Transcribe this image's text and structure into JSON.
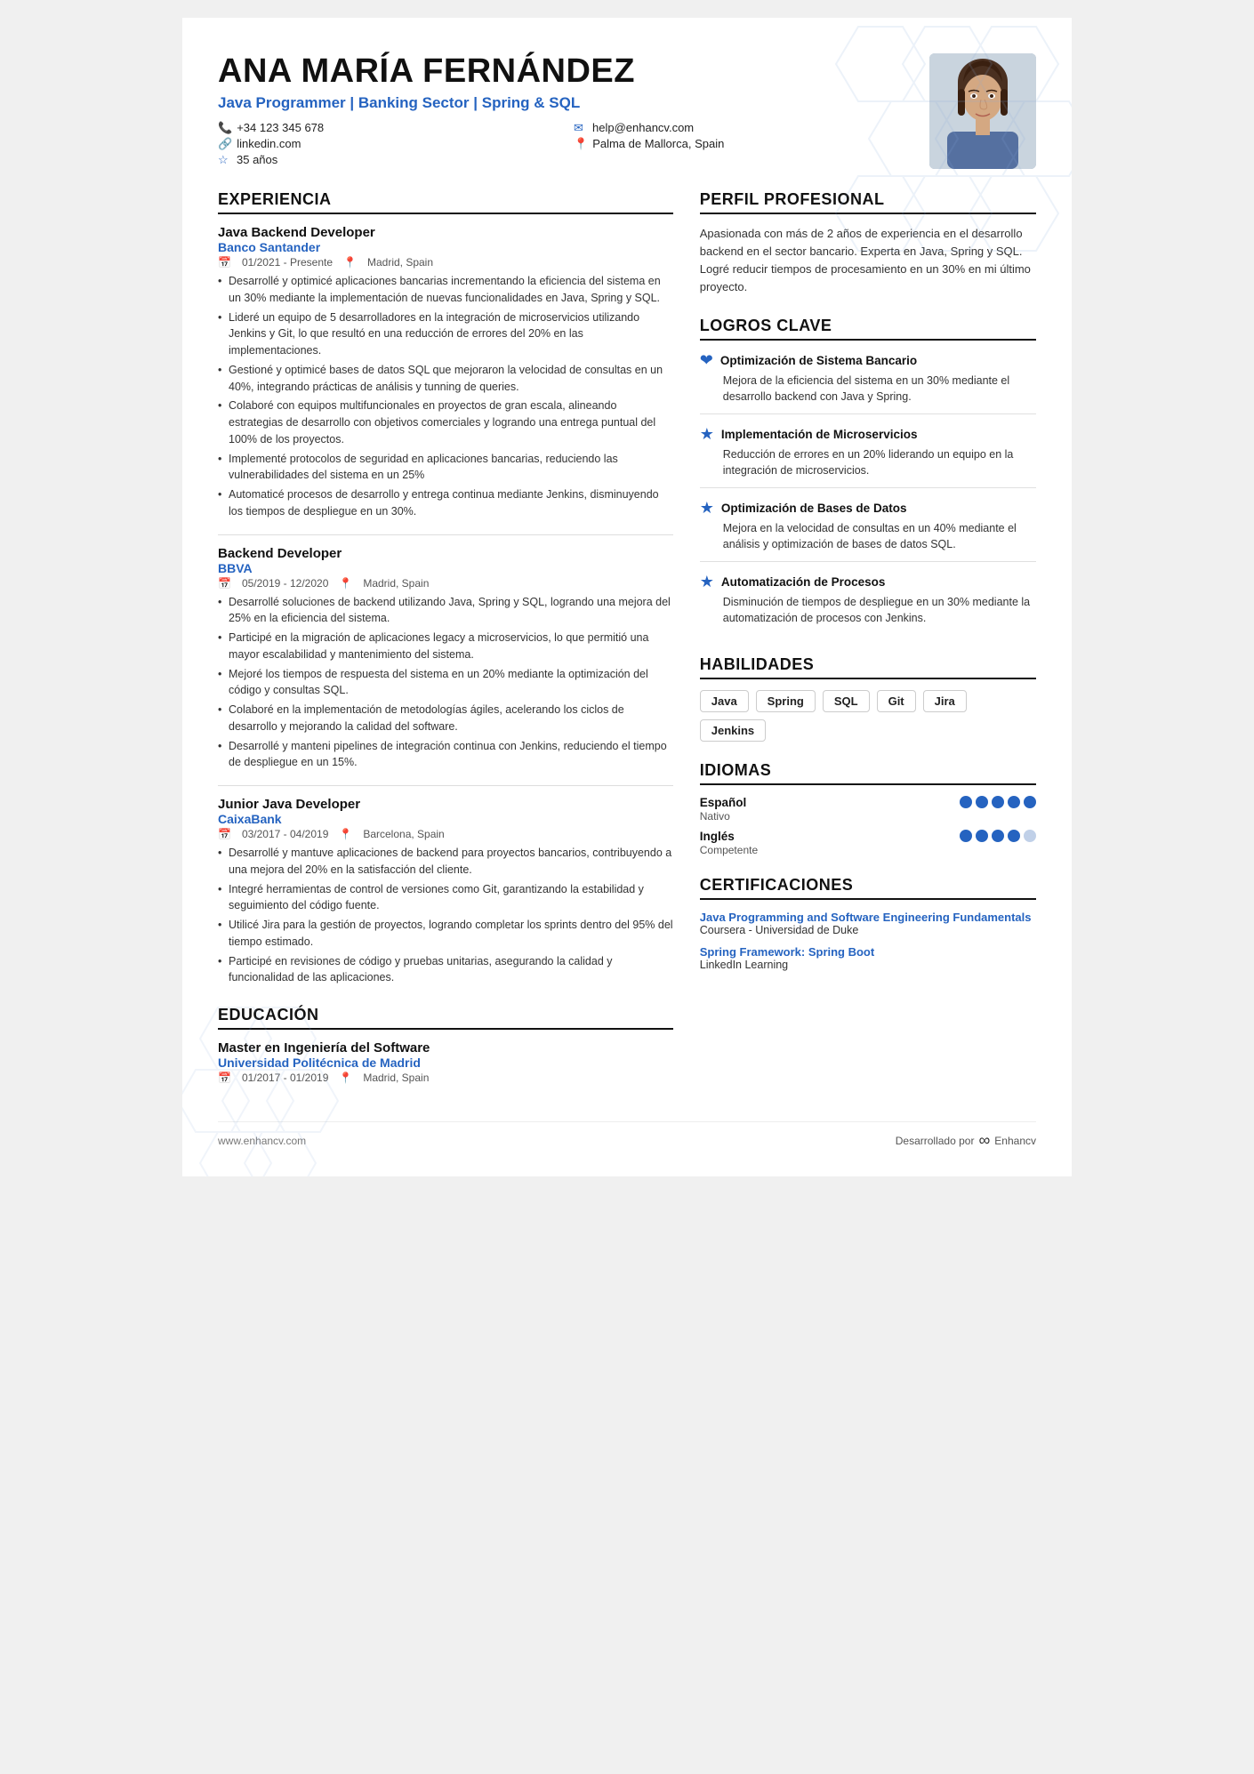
{
  "header": {
    "name": "ANA MARÍA FERNÁNDEZ",
    "title": "Java Programmer | Banking Sector | Spring & SQL",
    "contacts": [
      {
        "icon": "📞",
        "text": "+34 123 345 678"
      },
      {
        "icon": "✉",
        "text": "help@enhancv.com"
      },
      {
        "icon": "🔗",
        "text": "linkedin.com"
      },
      {
        "icon": "📍",
        "text": "Palma de Mallorca, Spain"
      },
      {
        "icon": "☆",
        "text": "35 años"
      }
    ]
  },
  "experiencia": {
    "section_title": "EXPERIENCIA",
    "items": [
      {
        "role": "Java Backend Developer",
        "company": "Banco Santander",
        "period": "01/2021 - Presente",
        "location": "Madrid, Spain",
        "bullets": [
          "Desarrollé y optimicé aplicaciones bancarias incrementando la eficiencia del sistema en un 30% mediante la implementación de nuevas funcionalidades en Java, Spring y SQL.",
          "Lideré un equipo de 5 desarrolladores en la integración de microservicios utilizando Jenkins y Git, lo que resultó en una reducción de errores del 20% en las implementaciones.",
          "Gestioné y optimicé bases de datos SQL que mejoraron la velocidad de consultas en un 40%, integrando prácticas de análisis y tunning de queries.",
          "Colaboré con equipos multifuncionales en proyectos de gran escala, alineando estrategias de desarrollo con objetivos comerciales y logrando una entrega puntual del 100% de los proyectos.",
          "Implementé protocolos de seguridad en aplicaciones bancarias, reduciendo las vulnerabilidades del sistema en un 25%",
          "Automaticé procesos de desarrollo y entrega continua mediante Jenkins, disminuyendo los tiempos de despliegue en un 30%."
        ]
      },
      {
        "role": "Backend Developer",
        "company": "BBVA",
        "period": "05/2019 - 12/2020",
        "location": "Madrid, Spain",
        "bullets": [
          "Desarrollé soluciones de backend utilizando Java, Spring y SQL, logrando una mejora del 25% en la eficiencia del sistema.",
          "Participé en la migración de aplicaciones legacy a microservicios, lo que permitió una mayor escalabilidad y mantenimiento del sistema.",
          "Mejoré los tiempos de respuesta del sistema en un 20% mediante la optimización del código y consultas SQL.",
          "Colaboré en la implementación de metodologías ágiles, acelerando los ciclos de desarrollo y mejorando la calidad del software.",
          "Desarrollé y manteni pipelines de integración continua con Jenkins, reduciendo el tiempo de despliegue en un 15%."
        ]
      },
      {
        "role": "Junior Java Developer",
        "company": "CaixaBank",
        "period": "03/2017 - 04/2019",
        "location": "Barcelona, Spain",
        "bullets": [
          "Desarrollé y mantuve aplicaciones de backend para proyectos bancarios, contribuyendo a una mejora del 20% en la satisfacción del cliente.",
          "Integré herramientas de control de versiones como Git, garantizando la estabilidad y seguimiento del código fuente.",
          "Utilicé Jira para la gestión de proyectos, logrando completar los sprints dentro del 95% del tiempo estimado.",
          "Participé en revisiones de código y pruebas unitarias, asegurando la calidad y funcionalidad de las aplicaciones."
        ]
      }
    ]
  },
  "educacion": {
    "section_title": "EDUCACIÓN",
    "items": [
      {
        "degree": "Master en Ingeniería del Software",
        "school": "Universidad Politécnica de Madrid",
        "period": "01/2017 - 01/2019",
        "location": "Madrid, Spain"
      }
    ]
  },
  "perfil": {
    "section_title": "PERFIL PROFESIONAL",
    "text": "Apasionada con más de 2 años de experiencia en el desarrollo backend en el sector bancario. Experta en Java, Spring y SQL. Logré reducir tiempos de procesamiento en un 30% en mi último proyecto."
  },
  "logros": {
    "section_title": "LOGROS CLAVE",
    "items": [
      {
        "icon_type": "heart",
        "title": "Optimización de Sistema Bancario",
        "desc": "Mejora de la eficiencia del sistema en un 30% mediante el desarrollo backend con Java y Spring."
      },
      {
        "icon_type": "star",
        "title": "Implementación de Microservicios",
        "desc": "Reducción de errores en un 20% liderando un equipo en la integración de microservicios."
      },
      {
        "icon_type": "star",
        "title": "Optimización de Bases de Datos",
        "desc": "Mejora en la velocidad de consultas en un 40% mediante el análisis y optimización de bases de datos SQL."
      },
      {
        "icon_type": "star",
        "title": "Automatización de Procesos",
        "desc": "Disminución de tiempos de despliegue en un 30% mediante la automatización de procesos con Jenkins."
      }
    ]
  },
  "habilidades": {
    "section_title": "HABILIDADES",
    "skills": [
      "Java",
      "Spring",
      "SQL",
      "Git",
      "Jira",
      "Jenkins"
    ]
  },
  "idiomas": {
    "section_title": "IDIOMAS",
    "items": [
      {
        "name": "Español",
        "level": "Nativo",
        "filled": 5,
        "total": 5
      },
      {
        "name": "Inglés",
        "level": "Competente",
        "filled": 4,
        "total": 5
      }
    ]
  },
  "certificaciones": {
    "section_title": "CERTIFICACIONES",
    "items": [
      {
        "title": "Java Programming and Software Engineering Fundamentals",
        "issuer": "Coursera - Universidad de Duke"
      },
      {
        "title": "Spring Framework: Spring Boot",
        "issuer": "LinkedIn Learning"
      }
    ]
  },
  "footer": {
    "website": "www.enhancv.com",
    "brand_label": "Desarrollado por",
    "brand_name": "Enhancv"
  }
}
